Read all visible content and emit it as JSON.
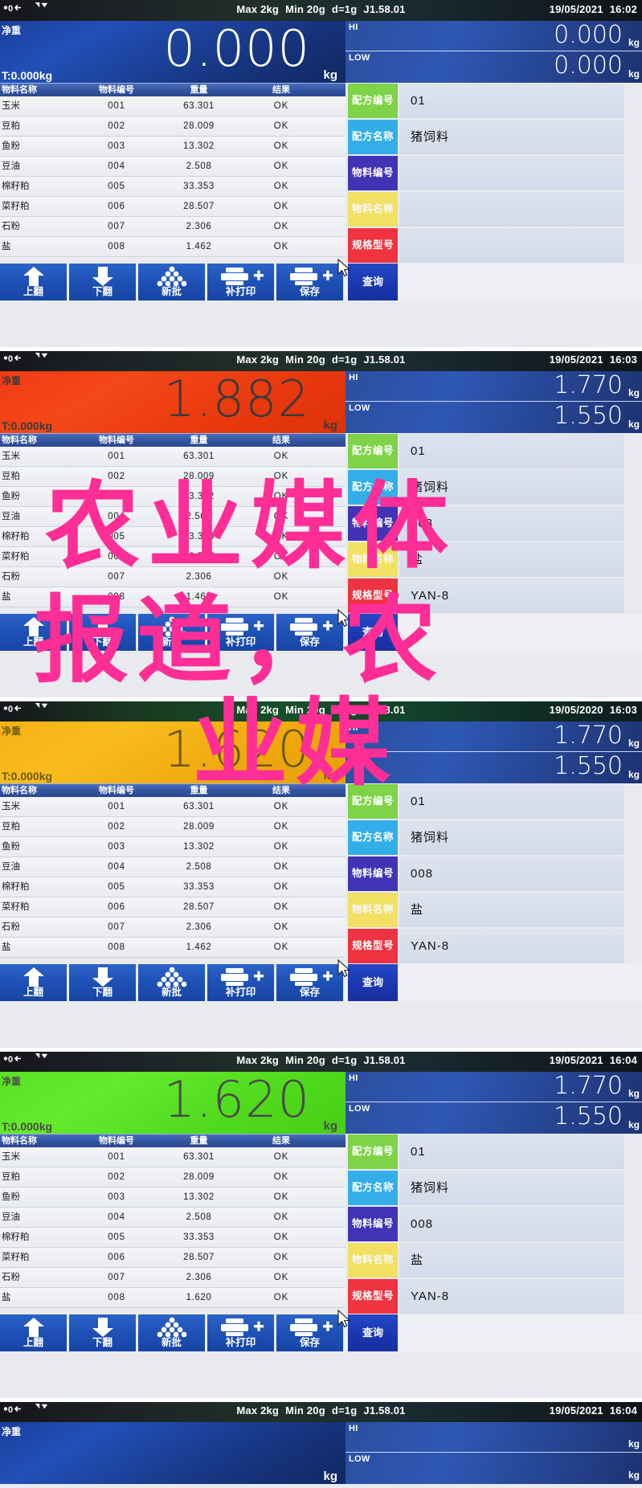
{
  "device": {
    "spec": {
      "max": "Max 2kg",
      "min": "Min 20g",
      "division": "d=1g",
      "version": "J1.58.01"
    },
    "indicators": {
      "zero": "0",
      "stable": "stable-icon"
    },
    "units": {
      "kg": "kg"
    },
    "labels": {
      "net": "净重",
      "tare_prefix": "T:",
      "hi": "HI",
      "low": "LOW"
    }
  },
  "table": {
    "headers": [
      "物料名称",
      "物料编号",
      "重量",
      "结果"
    ]
  },
  "form": {
    "fields": [
      {
        "label": "配方编号",
        "color": "#7ed349",
        "name": "recipe-number"
      },
      {
        "label": "配方名称",
        "color": "#33aee8",
        "name": "recipe-name"
      },
      {
        "label": "物料编号",
        "color": "#4233b5",
        "name": "material-number"
      },
      {
        "label": "物料名称",
        "color": "#f7dd30",
        "name": "material-name"
      },
      {
        "label": "规格型号",
        "color": "#ef3340",
        "name": "spec-model"
      }
    ],
    "query_label": "查询"
  },
  "toolbar": {
    "buttons": [
      {
        "label": "上翻",
        "icon": "arrow-up-icon"
      },
      {
        "label": "下翻",
        "icon": "arrow-down-icon"
      },
      {
        "label": "新批",
        "icon": "batch-icon"
      },
      {
        "label": "补打印",
        "icon": "reprint-icon"
      },
      {
        "label": "保存",
        "icon": "save-print-icon"
      }
    ]
  },
  "panels": [
    {
      "id": "panel-1",
      "datetime": {
        "date": "19/05/2021",
        "time": "16:02"
      },
      "weight": {
        "value": "0.000",
        "unit": "kg",
        "color": "blue"
      },
      "tare": "T:0.000kg",
      "hi": "0.000",
      "low": "0.000",
      "form_values": [
        "01",
        "猪饲料",
        "",
        "",
        ""
      ],
      "highlight_field": 3,
      "rows": [
        {
          "name": "玉米",
          "code": "001",
          "weight": "63.301",
          "result": "OK"
        },
        {
          "name": "豆粕",
          "code": "002",
          "weight": "28.009",
          "result": "OK"
        },
        {
          "name": "鱼粉",
          "code": "003",
          "weight": "13.302",
          "result": "OK"
        },
        {
          "name": "豆油",
          "code": "004",
          "weight": "2.508",
          "result": "OK"
        },
        {
          "name": "棉籽粕",
          "code": "005",
          "weight": "33.353",
          "result": "OK"
        },
        {
          "name": "菜籽粕",
          "code": "006",
          "weight": "28.507",
          "result": "OK"
        },
        {
          "name": "石粉",
          "code": "007",
          "weight": "2.306",
          "result": "OK"
        },
        {
          "name": "盐",
          "code": "008",
          "weight": "1.462",
          "result": "OK"
        }
      ]
    },
    {
      "id": "panel-2",
      "datetime": {
        "date": "19/05/2021",
        "time": "16:03"
      },
      "weight": {
        "value": "1.882",
        "unit": "kg",
        "color": "red"
      },
      "tare": "T:0.000kg",
      "hi": "1.770",
      "low": "1.550",
      "form_values": [
        "01",
        "猪饲料",
        "008",
        "盐",
        "YAN-8"
      ],
      "highlight_field": 3,
      "rows": [
        {
          "name": "玉米",
          "code": "001",
          "weight": "63.301",
          "result": "OK"
        },
        {
          "name": "豆粕",
          "code": "002",
          "weight": "28.009",
          "result": "OK"
        },
        {
          "name": "鱼粉",
          "code": "003",
          "weight": "13.302",
          "result": "OK"
        },
        {
          "name": "豆油",
          "code": "004",
          "weight": "2.508",
          "result": "OK"
        },
        {
          "name": "棉籽粕",
          "code": "005",
          "weight": "33.353",
          "result": "OK"
        },
        {
          "name": "菜籽粕",
          "code": "006",
          "weight": "28.507",
          "result": "OK"
        },
        {
          "name": "石粉",
          "code": "007",
          "weight": "2.306",
          "result": "OK"
        },
        {
          "name": "盐",
          "code": "008",
          "weight": "1.462",
          "result": "OK"
        }
      ]
    },
    {
      "id": "panel-3",
      "datetime": {
        "date": "19/05/2020",
        "time": "16:03"
      },
      "weight": {
        "value": "1.620",
        "unit": "kg",
        "color": "orange"
      },
      "tare": "T:0.000kg",
      "hi": "1.770",
      "low": "1.550",
      "form_values": [
        "01",
        "猪饲料",
        "008",
        "盐",
        "YAN-8"
      ],
      "highlight_field": 3,
      "rows": [
        {
          "name": "玉米",
          "code": "001",
          "weight": "63.301",
          "result": "OK"
        },
        {
          "name": "豆粕",
          "code": "002",
          "weight": "28.009",
          "result": "OK"
        },
        {
          "name": "鱼粉",
          "code": "003",
          "weight": "13.302",
          "result": "OK"
        },
        {
          "name": "豆油",
          "code": "004",
          "weight": "2.508",
          "result": "OK"
        },
        {
          "name": "棉籽粕",
          "code": "005",
          "weight": "33.353",
          "result": "OK"
        },
        {
          "name": "菜籽粕",
          "code": "006",
          "weight": "28.507",
          "result": "OK"
        },
        {
          "name": "石粉",
          "code": "007",
          "weight": "2.306",
          "result": "OK"
        },
        {
          "name": "盐",
          "code": "008",
          "weight": "1.462",
          "result": "OK"
        }
      ]
    },
    {
      "id": "panel-4",
      "datetime": {
        "date": "19/05/2021",
        "time": "16:04"
      },
      "weight": {
        "value": "1.620",
        "unit": "kg",
        "color": "green"
      },
      "tare": "T:0.000kg",
      "hi": "1.770",
      "low": "1.550",
      "form_values": [
        "01",
        "猪饲料",
        "008",
        "盐",
        "YAN-8"
      ],
      "highlight_field": 3,
      "rows": [
        {
          "name": "玉米",
          "code": "001",
          "weight": "63.301",
          "result": "OK"
        },
        {
          "name": "豆粕",
          "code": "002",
          "weight": "28.009",
          "result": "OK"
        },
        {
          "name": "鱼粉",
          "code": "003",
          "weight": "13.302",
          "result": "OK"
        },
        {
          "name": "豆油",
          "code": "004",
          "weight": "2.508",
          "result": "OK"
        },
        {
          "name": "棉籽粕",
          "code": "005",
          "weight": "33.353",
          "result": "OK"
        },
        {
          "name": "菜籽粕",
          "code": "006",
          "weight": "28.507",
          "result": "OK"
        },
        {
          "name": "石粉",
          "code": "007",
          "weight": "2.306",
          "result": "OK"
        },
        {
          "name": "盐",
          "code": "008",
          "weight": "1.620",
          "result": "OK"
        }
      ]
    },
    {
      "id": "panel-5",
      "partial": true,
      "datetime": {
        "date": "19/05/2021",
        "time": "16:04"
      },
      "weight": {
        "value": "",
        "unit": "kg",
        "color": "blue"
      },
      "tare": "",
      "hi": "",
      "low": "",
      "form_values": [
        "",
        "",
        "",
        "",
        ""
      ],
      "highlight_field": -1,
      "rows": []
    }
  ],
  "watermark": {
    "lines": [
      "农业媒体",
      "报道，农",
      "业媒"
    ],
    "color": "#ff2d96"
  }
}
